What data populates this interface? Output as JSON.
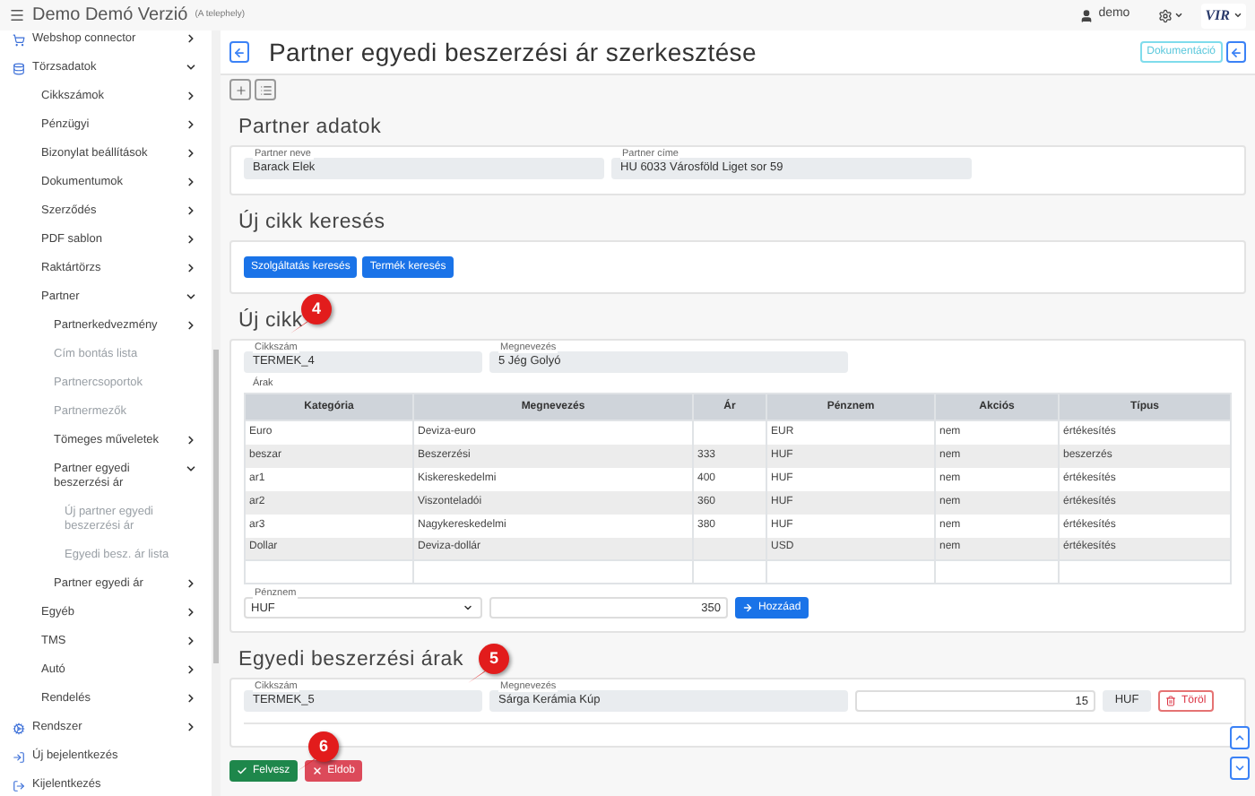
{
  "header": {
    "title": "Demo Demó Verzió",
    "subtitle": "(A telephely)",
    "user": "demo",
    "logo": "VIR"
  },
  "sidebar": {
    "items": [
      {
        "label": "Webshop connector",
        "expanded": false
      },
      {
        "label": "Törzsadatok",
        "expanded": true,
        "children": [
          {
            "label": "Cikkszámok",
            "expanded": false
          },
          {
            "label": "Pénzügyi",
            "expanded": false
          },
          {
            "label": "Bizonylat beállítások",
            "expanded": false
          },
          {
            "label": "Dokumentumok",
            "expanded": false
          },
          {
            "label": "Szerződés",
            "expanded": false
          },
          {
            "label": "PDF sablon",
            "expanded": false
          },
          {
            "label": "Raktártörzs",
            "expanded": false
          },
          {
            "label": "Partner",
            "expanded": true,
            "children": [
              {
                "label": "Partnerkedvezmény",
                "expanded": false
              },
              {
                "label": "Cím bontás lista"
              },
              {
                "label": "Partnercsoportok"
              },
              {
                "label": "Partnermezők"
              },
              {
                "label": "Tömeges műveletek",
                "expanded": false
              },
              {
                "label": "Partner egyedi beszerzési ár",
                "expanded": true,
                "children": [
                  {
                    "label": "Új partner egyedi beszerzési ár"
                  },
                  {
                    "label": "Egyedi besz. ár lista"
                  }
                ]
              },
              {
                "label": "Partner egyedi ár",
                "expanded": false
              }
            ]
          },
          {
            "label": "Egyéb",
            "expanded": false
          },
          {
            "label": "TMS",
            "expanded": false
          },
          {
            "label": "Autó",
            "expanded": false
          },
          {
            "label": "Rendelés",
            "expanded": false
          }
        ]
      },
      {
        "label": "Rendszer",
        "expanded": false
      },
      {
        "label": "Új bejelentkezés"
      },
      {
        "label": "Kijelentkezés"
      }
    ]
  },
  "page": {
    "title": "Partner egyedi beszerzési ár szerkesztése",
    "doc_button": "Dokumentáció"
  },
  "partner": {
    "heading": "Partner adatok",
    "fields": [
      {
        "label": "Partner neve",
        "value": "Barack Elek"
      },
      {
        "label": "Partner címe",
        "value": "HU 6033 Városföld Liget sor 59"
      }
    ]
  },
  "search": {
    "heading": "Új cikk keresés",
    "buttons": [
      "Szolgáltatás keresés",
      "Termék keresés"
    ]
  },
  "new_item": {
    "heading": "Új cikk",
    "fields": [
      {
        "label": "Cikkszám",
        "value": "TERMEK_4"
      },
      {
        "label": "Megnevezés",
        "value": "5 Jég Golyó"
      }
    ],
    "prices_label": "Árak",
    "table": {
      "columns": [
        "Kategória",
        "Megnevezés",
        "Ár",
        "Pénznem",
        "Akciós",
        "Típus"
      ],
      "rows": [
        [
          "Euro",
          "Deviza-euro",
          "",
          "EUR",
          "nem",
          "értékesítés"
        ],
        [
          "beszar",
          "Beszerzési",
          "333",
          "HUF",
          "nem",
          "beszerzés"
        ],
        [
          "ar1",
          "Kiskereskedelmi",
          "400",
          "HUF",
          "nem",
          "értékesítés"
        ],
        [
          "ar2",
          "Viszonteladói",
          "360",
          "HUF",
          "nem",
          "értékesítés"
        ],
        [
          "ar3",
          "Nagykereskedelmi",
          "380",
          "HUF",
          "nem",
          "értékesítés"
        ],
        [
          "Dollar",
          "Deviza-dollár",
          "",
          "USD",
          "nem",
          "értékesítés"
        ]
      ]
    },
    "currency": {
      "label": "Pénznem",
      "value": "HUF"
    },
    "amount": "350",
    "add_button": "Hozzáad"
  },
  "custom_prices": {
    "heading": "Egyedi beszerzési árak",
    "rows": [
      {
        "fields": [
          {
            "label": "Cikkszám",
            "value": "TERMEK_5"
          },
          {
            "label": "Megnevezés",
            "value": "Sárga Kerámia Kúp"
          }
        ],
        "amount": "15",
        "currency": "HUF",
        "delete_button": "Töröl"
      }
    ]
  },
  "actions": [
    {
      "label": "Felvesz",
      "kind": "confirm"
    },
    {
      "label": "Eldob",
      "kind": "discard"
    }
  ],
  "callouts": [
    "4",
    "5",
    "6"
  ]
}
